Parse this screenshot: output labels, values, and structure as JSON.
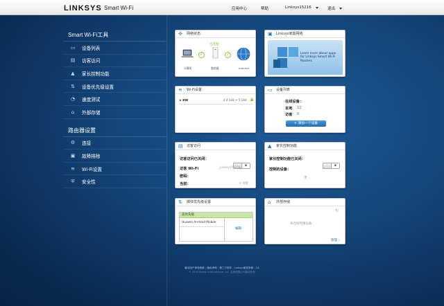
{
  "header": {
    "logo": "LINKSYS",
    "product": "Smart Wi-Fi",
    "nav": {
      "help_center": "应用中心",
      "help": "帮助",
      "account": "Linksys15216",
      "logout": "退出"
    }
  },
  "sidebar": {
    "tools_title": "Smart Wi-Fi工具",
    "tools": [
      {
        "label": "设备列表",
        "icon": "device-list-icon"
      },
      {
        "label": "访客访问",
        "icon": "guest-access-icon"
      },
      {
        "label": "家长控制功能",
        "icon": "warning-icon"
      },
      {
        "label": "设备优先级设置",
        "icon": "priority-icon"
      },
      {
        "label": "速度测试",
        "icon": "speedometer-icon"
      },
      {
        "label": "外部存储",
        "icon": "storage-icon"
      }
    ],
    "router_title": "路由器设置",
    "router": [
      {
        "label": "连接",
        "icon": "connectivity-icon"
      },
      {
        "label": "故障排除",
        "icon": "troubleshoot-icon"
      },
      {
        "label": "Wi-Fi设置",
        "icon": "wifi-icon"
      },
      {
        "label": "安全性",
        "icon": "shield-icon"
      }
    ]
  },
  "widgets": {
    "network_map": {
      "title": "网络状态",
      "status": "已连接",
      "computer": "计算机",
      "router": "路由器",
      "internet": "Internet"
    },
    "promo": {
      "title": "Linksys家庭网络",
      "text": "Learn more about apps for Linksys Smart Wi-Fi Routers"
    },
    "wifi": {
      "title": "Wi-Fi设置",
      "network": "ew",
      "bands": "2.4 GHz + 5 GHz"
    },
    "devices": {
      "title": "设备列表",
      "online_label": "在线设备：",
      "local_label": "本地",
      "local_count": "12",
      "guest_label": "访客",
      "guest_count": "0",
      "add_button": "添加一个设备"
    },
    "guest": {
      "title": "访客访问",
      "toggle_label": "访客访问已关闭：",
      "name_label": "访客 Wi-Fi",
      "name_value": "_Linksys15216...",
      "password_label": "密码：",
      "allowed_label": "当前：",
      "allowed_value": "0 访客"
    },
    "parental": {
      "title": "家长控制功能",
      "toggle_label": "家长控制功能已关闭：",
      "devices_label": "控制的设备：",
      "devices_value": "无"
    },
    "priority": {
      "title": "媒体优先级设置",
      "header": "高优先级",
      "device": "Huawei Android Mobile",
      "edit": "编辑"
    },
    "storage": {
      "title": "外部存储",
      "message": "未连接存储设备",
      "manage": "管理"
    }
  },
  "footer": {
    "links": [
      "最佳用户体验条款",
      "隐私声明",
      "第三方软件",
      "Linksys服务条款",
      "CA"
    ],
    "copyright": "© 2015 Belkin International, Inc. 及其附属公司版权所有"
  }
}
